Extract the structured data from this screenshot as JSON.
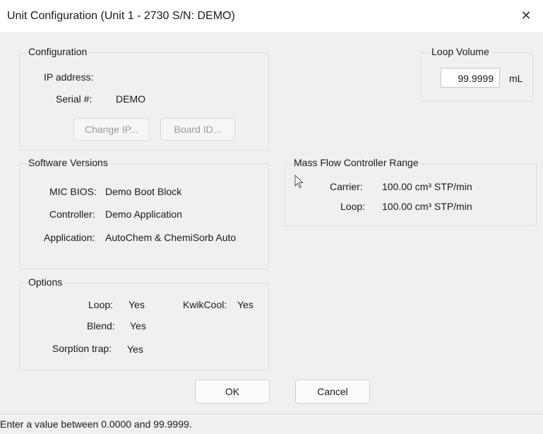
{
  "window": {
    "title": "Unit Configuration (Unit 1 - 2730 S/N: DEMO)"
  },
  "configuration": {
    "legend": "Configuration",
    "ip_label": "IP address:",
    "serial_label": "Serial #:",
    "serial_value": "DEMO",
    "change_ip_label": "Change IP...",
    "board_id_label": "Board ID..."
  },
  "loop_volume": {
    "legend": "Loop Volume",
    "value": "99.9999",
    "unit": "mL"
  },
  "software": {
    "legend": "Software Versions",
    "rows": [
      {
        "label": "MIC BIOS:",
        "value": "Demo Boot Block"
      },
      {
        "label": "Controller:",
        "value": "Demo Application"
      },
      {
        "label": "Application:",
        "value": "AutoChem & ChemiSorb Auto"
      }
    ]
  },
  "mfc": {
    "legend": "Mass Flow Controller Range",
    "rows": [
      {
        "label": "Carrier:",
        "value": "100.00 cm³ STP/min"
      },
      {
        "label": "Loop:",
        "value": "100.00 cm³ STP/min"
      }
    ]
  },
  "options": {
    "legend": "Options",
    "loop_label": "Loop:",
    "loop_value": "Yes",
    "kwikcool_label": "KwikCool:",
    "kwikcool_value": "Yes",
    "blend_label": "Blend:",
    "blend_value": "Yes",
    "sorption_label": "Sorption trap:",
    "sorption_value": "Yes"
  },
  "buttons": {
    "ok": "OK",
    "cancel": "Cancel"
  },
  "statusbar": {
    "text": "Enter a value between 0.0000 and 99.9999."
  },
  "icons": {
    "close": "close-icon",
    "cursor": "mouse-pointer-icon"
  }
}
